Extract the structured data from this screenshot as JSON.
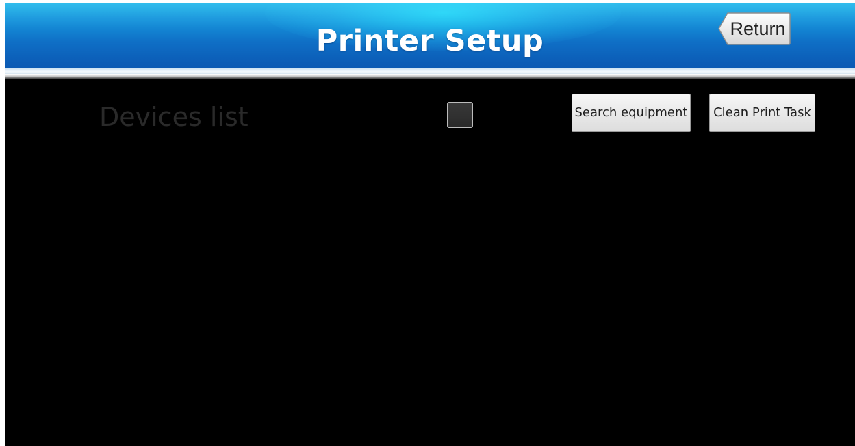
{
  "header": {
    "title": "Printer Setup",
    "return_label": "Return"
  },
  "main": {
    "devices_list_label": "Devices list",
    "select_all_checked": false,
    "buttons": {
      "search_equipment": "Search equipment",
      "clean_print_task": "Clean Print Task"
    }
  },
  "colors": {
    "header_blue": "#0f6fc6",
    "header_highlight": "#28e6ff",
    "background": "#000000",
    "button_face": "#e6e6e6",
    "label_text_dim": "#2a2a2a"
  }
}
